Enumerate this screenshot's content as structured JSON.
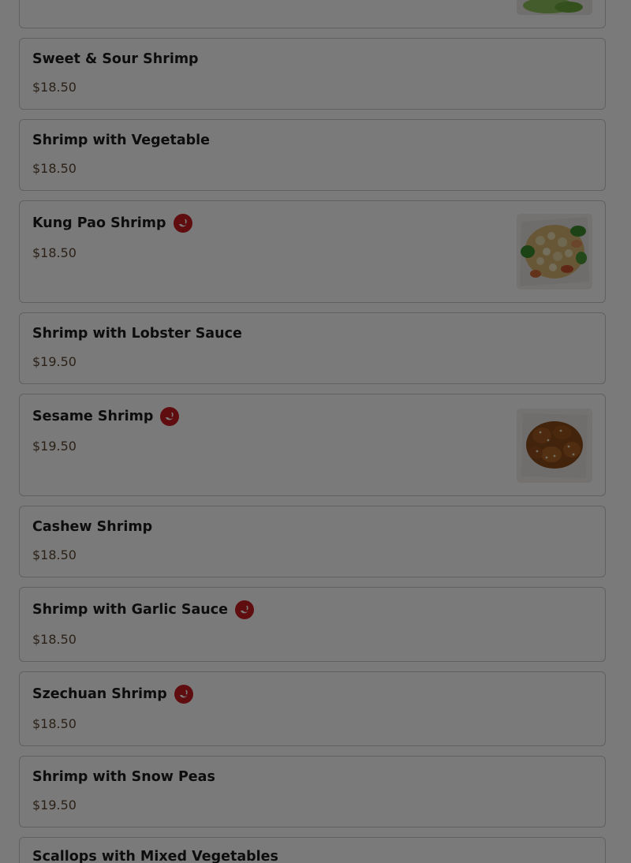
{
  "items": [
    {
      "name": "Sweet & Sour Shrimp",
      "price": "$18.50",
      "spicy": false
    },
    {
      "name": "Shrimp with Vegetable",
      "price": "$18.50",
      "spicy": false
    },
    {
      "name": "Kung Pao Shrimp",
      "price": "$18.50",
      "spicy": true,
      "image": "kung-pao-shrimp-photo"
    },
    {
      "name": "Shrimp with Lobster Sauce",
      "price": "$19.50",
      "spicy": false
    },
    {
      "name": "Sesame Shrimp",
      "price": "$19.50",
      "spicy": true,
      "image": "sesame-shrimp-photo"
    },
    {
      "name": "Cashew Shrimp",
      "price": "$18.50",
      "spicy": false
    },
    {
      "name": "Shrimp with Garlic Sauce",
      "price": "$18.50",
      "spicy": true
    },
    {
      "name": "Szechuan Shrimp",
      "price": "$18.50",
      "spicy": true
    },
    {
      "name": "Shrimp with Snow Peas",
      "price": "$19.50",
      "spicy": false
    },
    {
      "name": "Scallops with Mixed Vegetables",
      "price": "",
      "spicy": false
    }
  ],
  "colors": {
    "spicy_badge": "#c81d22",
    "price": "#5a4632",
    "overlay": "rgba(0,0,0,0.52)"
  },
  "icons": {
    "spicy": "chili-pepper-icon"
  }
}
